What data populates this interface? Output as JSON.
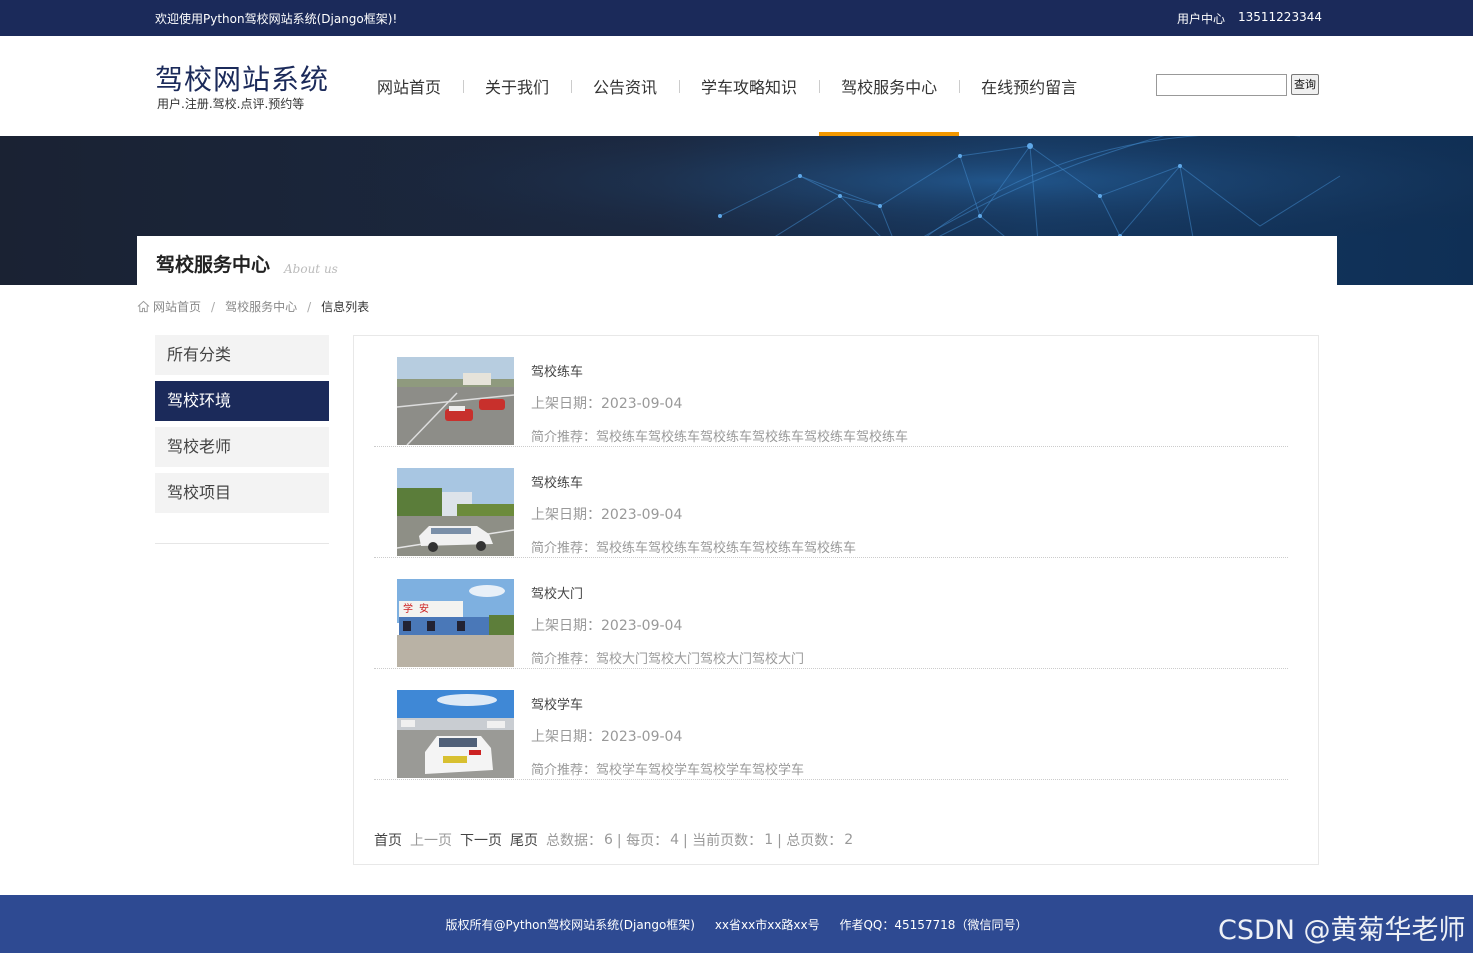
{
  "topbar": {
    "welcome": "欢迎使用Python驾校网站系统(Django框架)!",
    "user_center": "用户中心",
    "phone": "13511223344"
  },
  "header": {
    "logo_title": "驾校网站系统",
    "logo_subtitle": "用户.注册.驾校.点评.预约等",
    "nav": [
      "网站首页",
      "关于我们",
      "公告资讯",
      "学车攻略知识",
      "驾校服务中心",
      "在线预约留言"
    ],
    "active_nav": "驾校服务中心",
    "search_placeholder": "",
    "search_button": "查询"
  },
  "banner": {
    "title": "驾校服务中心",
    "subtitle": "About us"
  },
  "breadcrumb": [
    "网站首页",
    "驾校服务中心",
    "信息列表"
  ],
  "sidebar": {
    "items": [
      "所有分类",
      "驾校环境",
      "驾校老师",
      "驾校项目"
    ],
    "active": "驾校环境"
  },
  "items": [
    {
      "title": "驾校练车",
      "date": "上架日期：2023-09-04",
      "desc": "简介推荐：驾校练车驾校练车驾校练车驾校练车驾校练车驾校练车"
    },
    {
      "title": "驾校练车",
      "date": "上架日期：2023-09-04",
      "desc": "简介推荐：驾校练车驾校练车驾校练车驾校练车驾校练车"
    },
    {
      "title": "驾校大门",
      "date": "上架日期：2023-09-04",
      "desc": "简介推荐：驾校大门驾校大门驾校大门驾校大门"
    },
    {
      "title": "驾校学车",
      "date": "上架日期：2023-09-04",
      "desc": "简介推荐：驾校学车驾校学车驾校学车驾校学车"
    }
  ],
  "pager": {
    "first": "首页",
    "prev": "上一页",
    "next": "下一页",
    "last": "尾页",
    "total_label": "总数据：",
    "total": "6",
    "per_page_label": "| 每页：",
    "per_page": "4",
    "current_label": "| 当前页数：",
    "current": "1",
    "pages_label": "| 总页数：",
    "pages": "2"
  },
  "footer": {
    "copyright": "版权所有@Python驾校网站系统(Django框架)",
    "address": "xx省xx市xx路xx号",
    "author": "作者QQ：45157718（微信同号）"
  },
  "watermark": "CSDN @黄菊华老师",
  "colors": {
    "primary": "#1b2a5a",
    "accent": "#f39800",
    "footer": "#2e4a92"
  }
}
